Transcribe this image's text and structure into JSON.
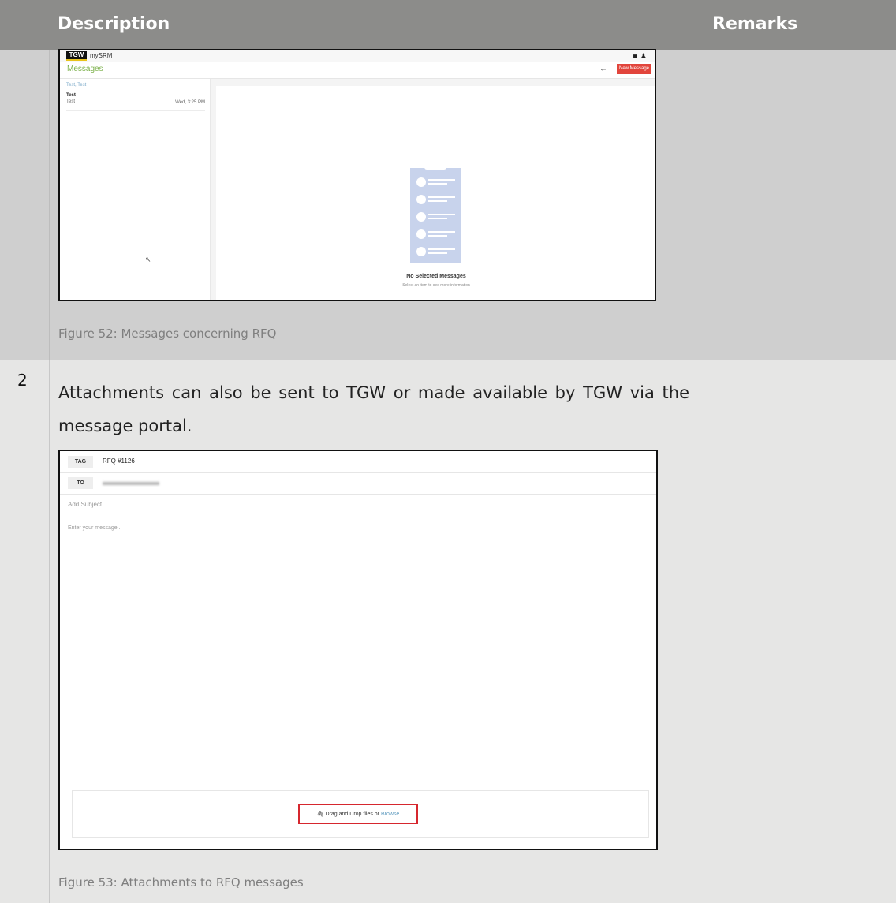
{
  "table": {
    "header_description": "Description",
    "header_remarks": "Remarks"
  },
  "row1": {
    "caption": "Figure 52: Messages concerning RFQ",
    "screenshot": {
      "logo_text": "TGW",
      "app_name": "mySRM",
      "icons": [
        "chat-icon",
        "user-icon"
      ],
      "title": "Messages",
      "back_arrow": "←",
      "new_message_button": "New Message",
      "filter_label": "Test, Test",
      "item_title": "Test",
      "item_subtitle": "Test",
      "item_time": "Wed, 3:25 PM",
      "empty_title": "No Selected Messages",
      "empty_subtitle": "Select an item to see more information",
      "accent_color": "#7cb14b",
      "button_color": "#e2453c"
    }
  },
  "row2": {
    "step_number": "2",
    "text": "Attachments can also be sent to TGW or made available by TGW via the message portal.",
    "caption": "Figure 53: Attachments to RFQ messages",
    "screenshot": {
      "tag_label": "TAG",
      "tag_value": "RFQ #1126",
      "to_label": "TO",
      "subject_placeholder": "Add Subject",
      "message_placeholder": "Enter your message...",
      "drop_text": "Drag and Drop files or",
      "browse_link": "Browse",
      "highlight_color": "#d6272e"
    }
  }
}
